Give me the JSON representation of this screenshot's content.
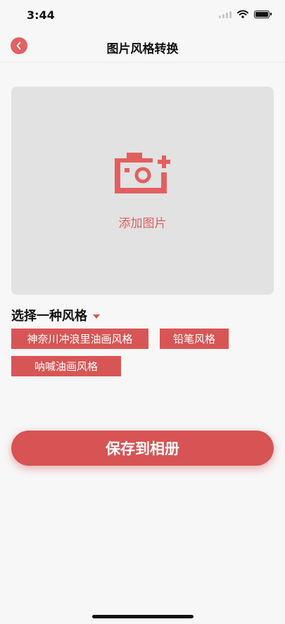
{
  "status_bar": {
    "time": "3:44",
    "icons": [
      "signal-icon",
      "wifi-icon",
      "battery-icon"
    ]
  },
  "nav": {
    "title": "图片风格转换",
    "back_icon": "chevron-left-icon"
  },
  "image_picker": {
    "label": "添加图片",
    "icon": "camera-add-icon"
  },
  "style_selector": {
    "heading": "选择一种风格",
    "icon": "caret-down-icon",
    "options": [
      "神奈川冲浪里油画风格",
      "铅笔风格",
      "呐喊油画风格"
    ]
  },
  "save": {
    "label": "保存到相册"
  },
  "colors": {
    "accent": "#d85555",
    "picker_background": "#e2e2e2",
    "page_background": "#f7f7f7"
  }
}
